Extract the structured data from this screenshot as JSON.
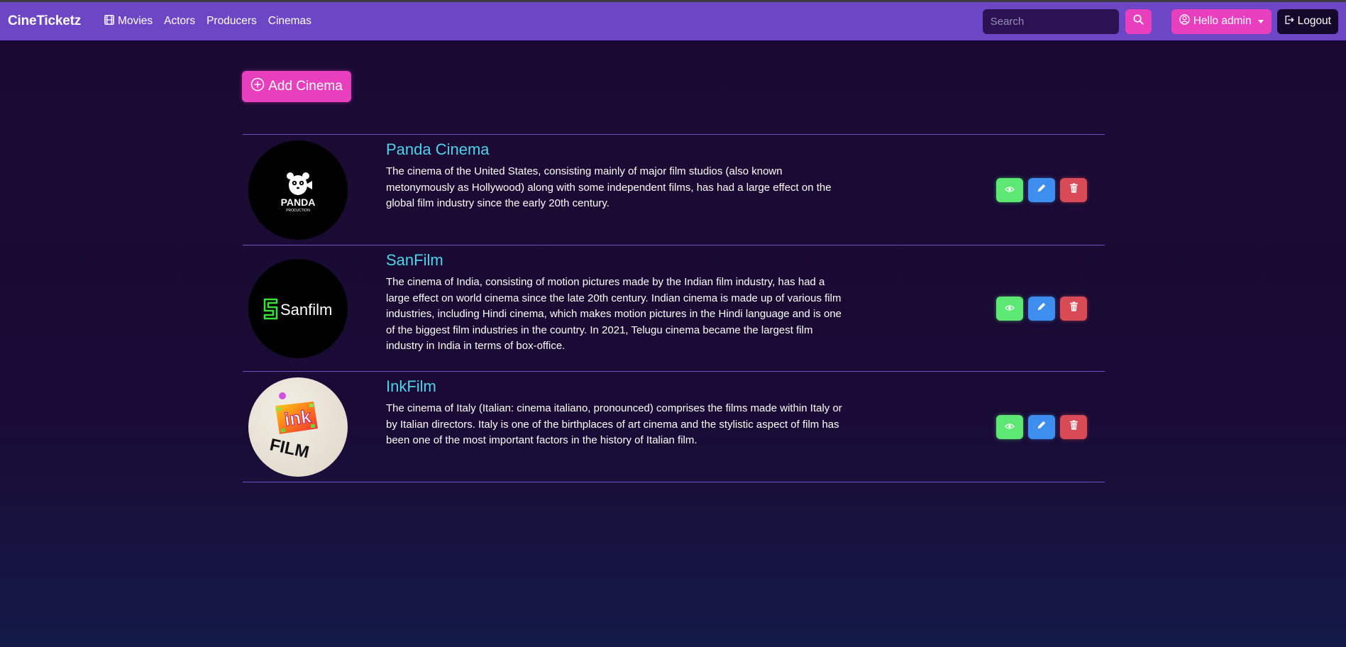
{
  "app": {
    "brand": "CineTicketz",
    "nav": [
      {
        "label": "Movies",
        "icon": "film-icon"
      },
      {
        "label": "Actors"
      },
      {
        "label": "Producers"
      },
      {
        "label": "Cinemas"
      }
    ],
    "search": {
      "placeholder": "Search"
    },
    "user_label": "Hello admin",
    "logout_label": "Logout"
  },
  "toolbar": {
    "add_label": "Add Cinema"
  },
  "cinemas": [
    {
      "name": "Panda Cinema",
      "logo_text": "PANDA",
      "logo_subtext": "PRODUCTION",
      "description": "The cinema of the United States, consisting mainly of major film studios (also known metonymously as Hollywood) along with some independent films, has had a large effect on the global film industry since the early 20th century."
    },
    {
      "name": "SanFilm",
      "logo_text": "Sanfilm",
      "description": "The cinema of India, consisting of motion pictures made by the Indian film industry, has had a large effect on world cinema since the late 20th century. Indian cinema is made up of various film industries, including Hindi cinema, which makes motion pictures in the Hindi language and is one of the biggest film industries in the country. In 2021, Telugu cinema became the largest film industry in India in terms of box-office."
    },
    {
      "name": "InkFilm",
      "logo_text": "ink",
      "logo_subtext": "FILM",
      "description": "The cinema of Italy (Italian: cinema italiano, pronounced) comprises the films made within Italy or by Italian directors. Italy is one of the birthplaces of art cinema and the stylistic aspect of film has been one of the most important factors in the history of Italian film."
    }
  ],
  "colors": {
    "navbar": "#6c46c4",
    "accent": "#e83fbe",
    "name": "#4fd3ea",
    "view": "#5ce873",
    "edit": "#3e8ef0",
    "delete": "#d94a57"
  }
}
